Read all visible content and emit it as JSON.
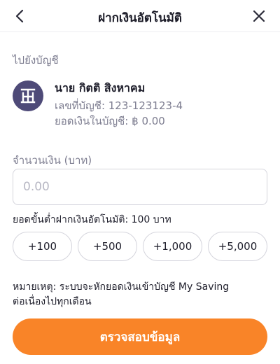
{
  "header": {
    "title": "ฝากเงินอัตโนมัติ",
    "back_icon": "chevron-left-icon",
    "close_icon": "close-icon"
  },
  "destination": {
    "label": "ไปยังบัญชี",
    "account_name": "นาย กิตติ สิงหาคม",
    "account_number": "เลขที่บัญชี: 123-123123-4",
    "balance": "ยอดเงินในบัญชี: ฿ 0.00",
    "avatar_icon": "bank-logo-icon",
    "avatar_color": "#4e4a78"
  },
  "amount": {
    "label": "จำนวนเงิน (บาท)",
    "value": "",
    "placeholder": "0.00"
  },
  "minimum_note": "ยอดขั้นต่ำฝากเงินอัตโนมัติ: 100 บาท",
  "quick_amounts": [
    "+100",
    "+500",
    "+1,000",
    "+5,000"
  ],
  "remark_line1": "หมายเหตุ: ระบบจะหักยอดเงินเข้าบัญชี My Saving",
  "remark_line2": "ต่อเนื่องไปทุกเดือน",
  "submit_label": "ตรวจสอบข้อมูล",
  "colors": {
    "accent": "#f98428",
    "text_primary": "#1d1d2a",
    "text_secondary": "#7d7d90",
    "border": "#d4d4dc"
  }
}
